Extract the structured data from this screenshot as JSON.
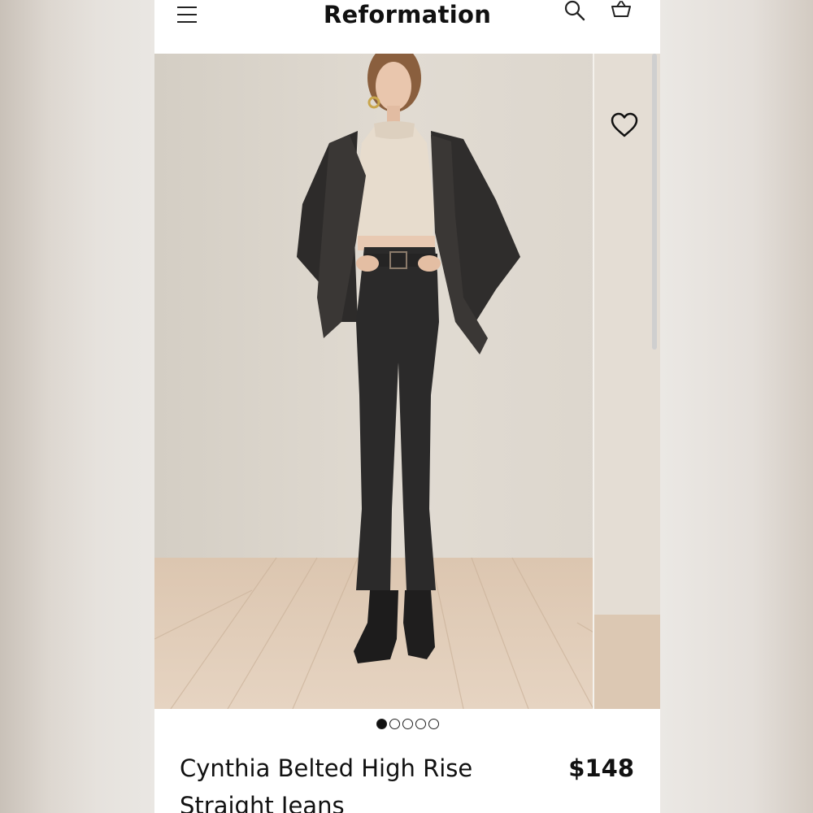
{
  "header": {
    "brand": "Reformation",
    "menu_icon": "hamburger-menu-icon",
    "search_icon": "search-icon",
    "cart_icon": "shopping-bag-icon"
  },
  "gallery": {
    "image_alt": "Model wearing black leather blazer, cream ribbed turtleneck crop top, black belted high-rise straight jeans and black ankle boots",
    "image_count": 5,
    "active_index": 0,
    "wishlist_icon": "heart-icon"
  },
  "product": {
    "name": "Cynthia Belted High Rise Straight Jeans",
    "price": "$148"
  },
  "colors": {
    "accent": "#111111",
    "background": "#ffffff"
  }
}
